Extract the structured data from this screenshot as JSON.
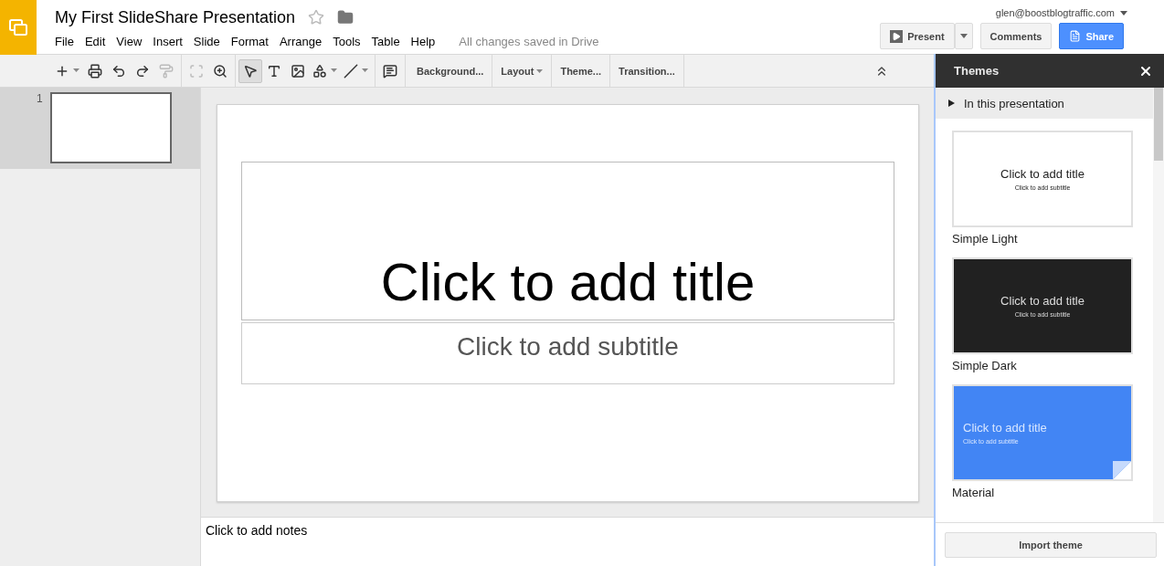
{
  "app": {
    "title": "My First SlideShare Presentation",
    "starred": false,
    "status": "All changes saved in Drive",
    "account": "glen@boostblogtraffic.com"
  },
  "menu": [
    "File",
    "Edit",
    "View",
    "Insert",
    "Slide",
    "Format",
    "Arrange",
    "Tools",
    "Table",
    "Help"
  ],
  "header_buttons": [
    {
      "kind": "present",
      "label": "Present"
    },
    {
      "kind": "plain",
      "label": "Comments"
    },
    {
      "kind": "share",
      "label": "Share"
    }
  ],
  "toolbar": {
    "tools": [
      {
        "kind": "new-slide",
        "selected": false,
        "disabled": false
      },
      {
        "kind": "print",
        "selected": false,
        "disabled": false
      },
      {
        "kind": "undo",
        "selected": false,
        "disabled": false
      },
      {
        "kind": "redo",
        "selected": false,
        "disabled": false
      },
      {
        "kind": "paint-format",
        "selected": false,
        "disabled": true
      },
      {
        "kind": "fit",
        "selected": false,
        "disabled": true
      },
      {
        "kind": "zoom",
        "selected": false,
        "disabled": false
      },
      {
        "kind": "select",
        "selected": true,
        "disabled": false
      },
      {
        "kind": "textbox",
        "selected": false,
        "disabled": false
      },
      {
        "kind": "image",
        "selected": false,
        "disabled": false
      },
      {
        "kind": "shape",
        "selected": false,
        "disabled": false
      },
      {
        "kind": "line",
        "selected": false,
        "disabled": false
      },
      {
        "kind": "comment",
        "selected": false,
        "disabled": false
      }
    ],
    "menus": [
      {
        "label": "Background...",
        "has_menu": false
      },
      {
        "label": "Layout",
        "has_menu": true
      },
      {
        "label": "Theme...",
        "has_menu": false
      },
      {
        "label": "Transition...",
        "has_menu": false
      }
    ]
  },
  "filmstrip": [
    {
      "number": "1",
      "selected": true
    }
  ],
  "slide": {
    "title": "Click to add title",
    "subtitle": "Click to add subtitle"
  },
  "notes": {
    "placeholder": "Click to add notes"
  },
  "themes_panel": {
    "title": "Themes",
    "section": {
      "label": "In this presentation",
      "expanded": false
    },
    "themes": [
      {
        "name": "Simple Light",
        "kind": "light",
        "title": "Click to add title",
        "subtitle": "Click to add subtitle"
      },
      {
        "name": "Simple Dark",
        "kind": "dark",
        "title": "Click to add title",
        "subtitle": "Click to add subtitle"
      },
      {
        "name": "Material",
        "kind": "material",
        "title": "Click to add title",
        "subtitle": "Click to add subtitle"
      }
    ],
    "import_button": "Import theme"
  }
}
